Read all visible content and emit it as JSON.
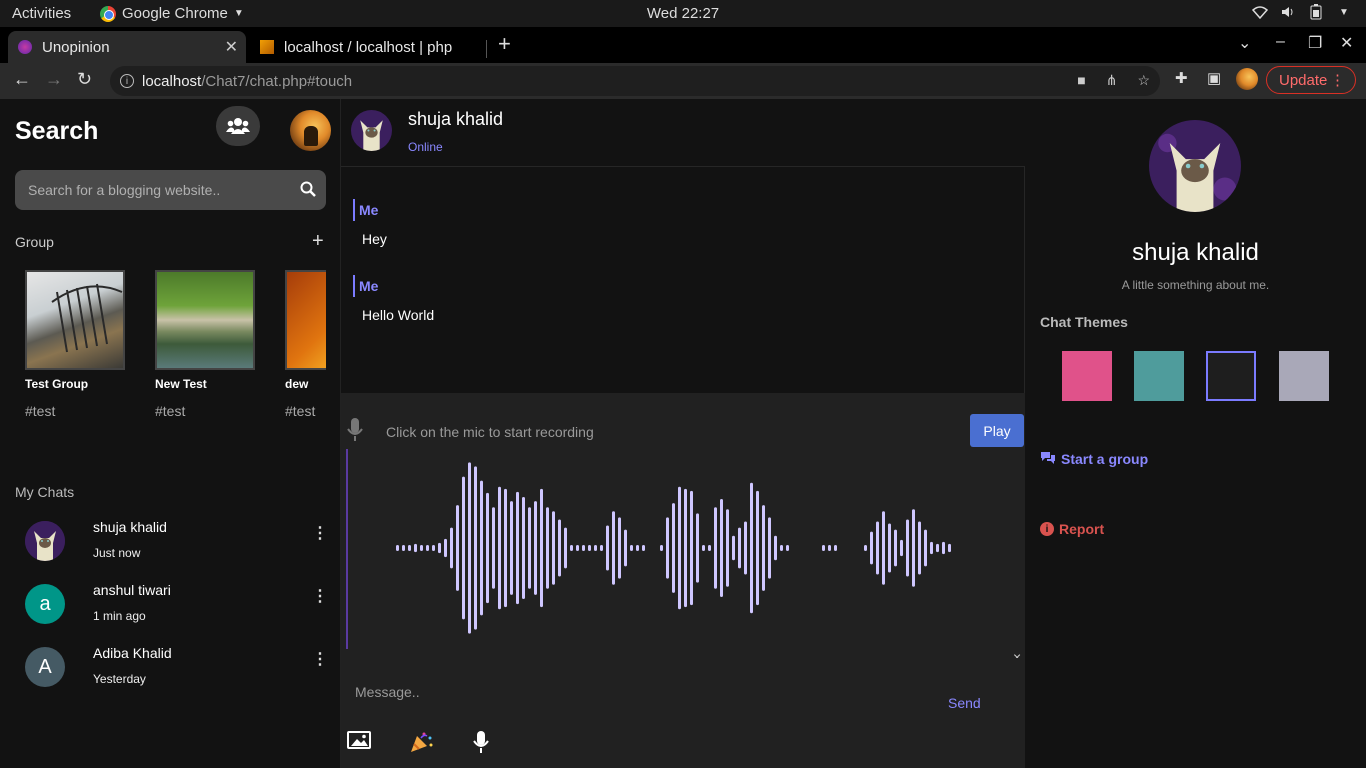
{
  "os": {
    "activities": "Activities",
    "app_name": "Google Chrome",
    "clock": "Wed 22:27"
  },
  "browser": {
    "tabs": [
      {
        "label": "Unopinion"
      },
      {
        "label": "localhost / localhost | php"
      }
    ],
    "url_host": "localhost",
    "url_path": "/Chat7/chat.php#touch",
    "update_label": "Update"
  },
  "sidebar": {
    "title": "Search",
    "search_placeholder": "Search for a blogging website..",
    "group_label": "Group",
    "groups": [
      {
        "name": "Test Group",
        "tag": "#test"
      },
      {
        "name": "New Test",
        "tag": "#test"
      },
      {
        "name": "dew",
        "tag": "#test"
      }
    ],
    "my_chats_label": "My Chats",
    "chats": [
      {
        "name": "shuja khalid",
        "time": "Just now",
        "initial": "",
        "color": "#3b1f5e"
      },
      {
        "name": "anshul tiwari",
        "time": "1 min ago",
        "initial": "a",
        "color": "#009688"
      },
      {
        "name": "Adiba Khalid",
        "time": "Yesterday",
        "initial": "A",
        "color": "#455a64"
      }
    ]
  },
  "chat": {
    "contact_name": "shuja khalid",
    "status": "Online",
    "messages": [
      {
        "sender": "Me",
        "text": "Hey"
      },
      {
        "sender": "Me",
        "text": "Hello World"
      }
    ],
    "recorder_hint": "Click on the mic to start recording",
    "play_label": "Play",
    "close_symbol": "×",
    "message_placeholder": "Message..",
    "send_label": "Send"
  },
  "profile": {
    "name": "shuja khalid",
    "bio": "A little something about me.",
    "themes_label": "Chat Themes",
    "themes": [
      "#e0528a",
      "#4f9c9c",
      "#1e1e1e",
      "#a9a8b8"
    ],
    "selected_theme_index": 2,
    "start_group_label": "Start a group",
    "report_label": "Report"
  },
  "colors": {
    "accent": "#8a88ff",
    "report": "#d9534f",
    "wave": "#cfc7ff"
  }
}
